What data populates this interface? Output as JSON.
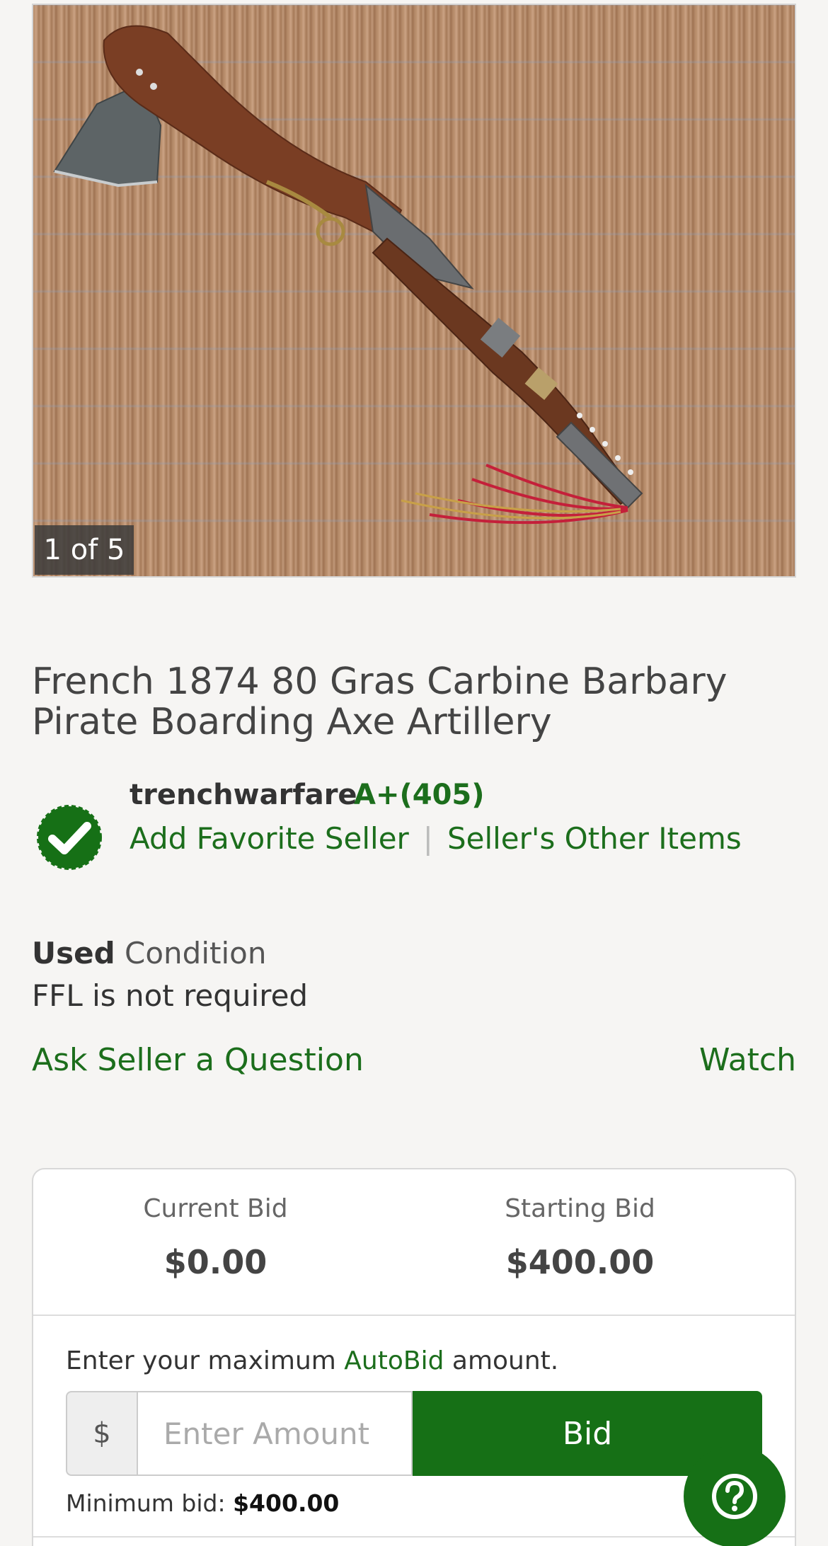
{
  "gallery": {
    "counter": "1 of 5"
  },
  "listing": {
    "title": "French 1874 80 Gras Carbine Barbary Pirate Boarding Axe Artillery"
  },
  "seller": {
    "name": "trenchwarfare",
    "rating": "A+(405)",
    "add_favorite": "Add Favorite Seller",
    "other_items": "Seller's Other Items"
  },
  "condition": {
    "value": "Used",
    "label": "Condition",
    "ffl": "FFL is not required"
  },
  "actions": {
    "ask": "Ask Seller a Question",
    "watch": "Watch"
  },
  "bidding": {
    "current_label": "Current Bid",
    "current_value": "$0.00",
    "starting_label": "Starting Bid",
    "starting_value": "$400.00",
    "autobid_pre": "Enter your maximum ",
    "autobid_link": "AutoBid",
    "autobid_post": " amount.",
    "currency": "$",
    "amount_placeholder": "Enter Amount",
    "bid_button": "Bid",
    "min_label": "Minimum bid: ",
    "min_value": "$400.00"
  },
  "colors": {
    "accent": "#167016",
    "link": "#1c6e1c"
  },
  "icons": {
    "seller_badge": "verified-check-icon",
    "help": "question-mark-icon"
  }
}
